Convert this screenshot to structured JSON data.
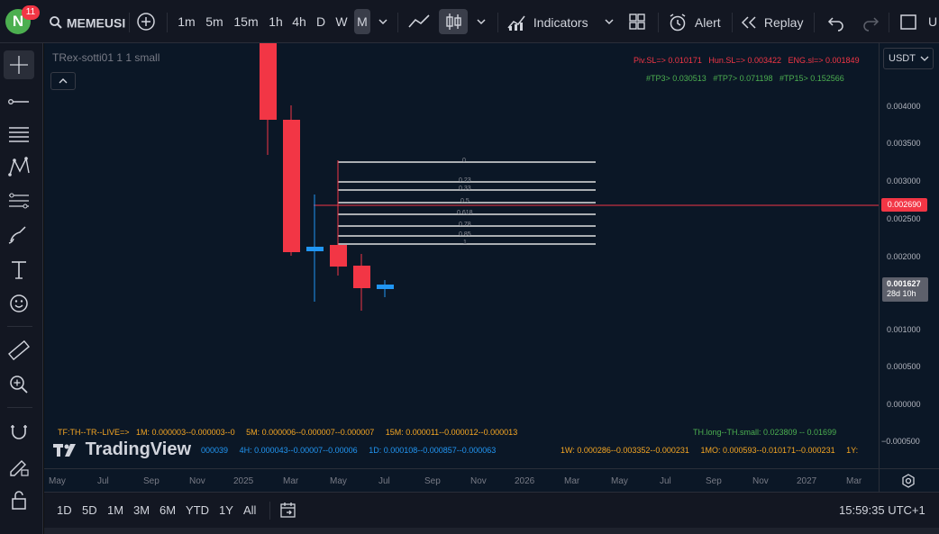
{
  "header": {
    "avatar_letter": "N",
    "notifications": "11",
    "symbol": "MEMEUSI",
    "intervals": [
      "1m",
      "5m",
      "15m",
      "1h",
      "4h",
      "D",
      "W",
      "M"
    ],
    "active_interval": "M",
    "indicators_label": "Indicators",
    "alert_label": "Alert",
    "replay_label": "Replay",
    "cut_label": "U"
  },
  "chart": {
    "indicator_name": "TRex-sotti01 1 1 small",
    "top_row1": [
      "Piv.SL=> 0.010171",
      "Hun.SL=> 0.003422",
      "ENG.sl=> 0.001849"
    ],
    "top_row2": [
      "#TP3> 0.030513",
      "#TP7> 0.071198",
      "#TP15> 0.152566"
    ],
    "bottom_row1_label": "TF:TH--TR--LIVE=>",
    "bottom_row1": [
      "1M: 0.000003--0.000003--0",
      "5M: 0.000006--0.000007--0.000007",
      "15M: 0.000011--0.000012--0.000013"
    ],
    "bottom_row1_right": "TH.long--TH.small: 0.023809 -- 0.01699",
    "bottom_row2": [
      "000039",
      "4H: 0.000043--0.00007--0.00006",
      "1D: 0.000108--0.000857--0.000063"
    ],
    "bottom_row2_right": [
      "1W: 0.000286--0.003352--0.000231",
      "1MO: 0.000593--0.010171--0.000231",
      "1Y:"
    ],
    "logo_text": "TradingView",
    "fib_levels": [
      "0",
      "0.23",
      "0.33",
      "0.5",
      "0.618",
      "0.78",
      "0.85",
      "1"
    ]
  },
  "price_axis": {
    "currency": "USDT",
    "labels": [
      "0.004000",
      "0.003500",
      "0.003000",
      "0.002500",
      "0.002000",
      "0.001000",
      "0.000500",
      "0.000000",
      "−0.000500"
    ],
    "red_tag": "0.002690",
    "last_price": "0.001627",
    "countdown": "28d 10h"
  },
  "time_axis": {
    "labels": [
      "May",
      "Jul",
      "Sep",
      "Nov",
      "2025",
      "Mar",
      "May",
      "Jul",
      "Sep",
      "Nov",
      "2026",
      "Mar",
      "May",
      "Jul",
      "Sep",
      "Nov",
      "2027",
      "Mar"
    ]
  },
  "bottom": {
    "ranges": [
      "1D",
      "5D",
      "1M",
      "3M",
      "6M",
      "YTD",
      "1Y",
      "All"
    ],
    "clock": "15:59:35 UTC+1"
  },
  "colors": {
    "up": "#2196f3",
    "down": "#f23645",
    "accent_orange": "#f5a623",
    "accent_green": "#4caf50",
    "accent_blue": "#2196f3"
  }
}
